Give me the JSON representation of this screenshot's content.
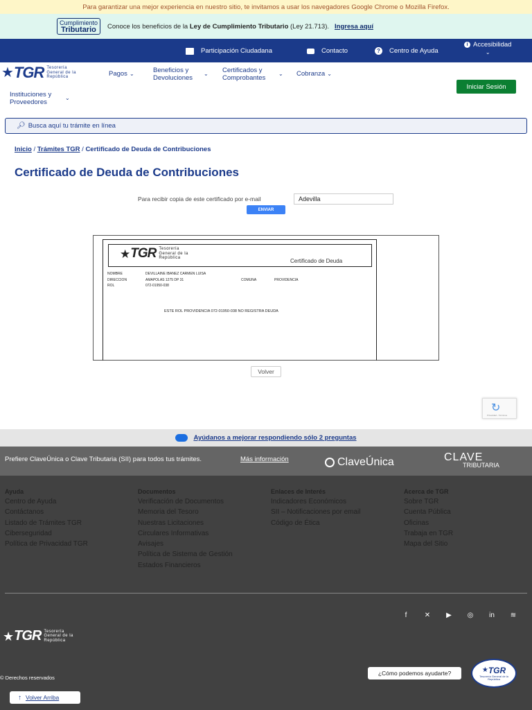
{
  "top_banner": {
    "text": "Para garantizar una mejor experiencia en nuestro sitio, te invitamos a usar los navegadores Google Chrome o Mozilla Firefox."
  },
  "ct_banner": {
    "logo_line1": "Cumplimiento",
    "logo_line2": "Tributario",
    "text_prefix": "Conoce los beneficios de la ",
    "text_bold": "Ley de Cumplimiento Tributario",
    "text_suffix": " (Ley 21.713).",
    "link": "Ingresa aquí"
  },
  "topbar": {
    "participacion": "Participación Ciudadana",
    "contacto": "Contacto",
    "centro_ayuda": "Centro de Ayuda",
    "accesibilidad": "Accesibilidad"
  },
  "logo": {
    "name": "TGR",
    "line1": "Tesorería",
    "line2": "General de la",
    "line3": "República"
  },
  "nav": {
    "pagos": "Pagos",
    "beneficios_1": "Beneficios y",
    "beneficios_2": "Devoluciones",
    "certificados_1": "Certificados y",
    "certificados_2": "Comprobantes",
    "cobranza": "Cobranza",
    "instituciones_1": "Instituciones y",
    "instituciones_2": "Proveedores",
    "login": "Iniciar Sesión"
  },
  "search": {
    "placeholder": "Busca aquí tu trámite en línea"
  },
  "breadcrumb": {
    "inicio": "Inicio",
    "tramites": "Trámites TGR",
    "current": "Certificado de Deuda de Contribuciones",
    "sep": "/"
  },
  "page": {
    "title": "Certificado de Deuda de Contribuciones",
    "email_label": "Para recibir copia de este certificado por e-mail",
    "email_value": "Adevilla",
    "enviar": "ENVIAR",
    "volver": "Volver"
  },
  "certificate": {
    "logo": "TGR",
    "logo_line1": "Tesorería",
    "logo_line2": "General de la",
    "logo_line3": "República",
    "doc_title": "Certificado de Deuda",
    "nombre_label": "NOMBRE",
    "nombre_value": "DEVILLAINE IBANEZ CARMEN LUISA",
    "direccion_label": "DIRECCION",
    "direccion_value": "AMAPOLAS 1275 DP 31",
    "comuna_label": "COMUNA",
    "comuna_value": "PROVIDENCIA",
    "rol_label": "ROL",
    "rol_value": "072-01950-038",
    "message": "ESTE ROL PROVIDENCIA 072-01950-038 NO REGISTRA DEUDA"
  },
  "recaptcha": {
    "text": "Privacidad - Términos"
  },
  "feedback": {
    "text": "Ayúdanos a mejorar respondiendo sólo 2 preguntas"
  },
  "clave": {
    "text": "Prefiere ClaveÚnica o Clave Tributaria (SII) para todos tus trámites.",
    "link": "Más información",
    "claveunica": "ClaveÚnica",
    "clave_tributaria_1": "CLAVE",
    "clave_tributaria_2": "TRIBUTARIA"
  },
  "footer": {
    "ayuda": {
      "heading": "Ayuda",
      "links": [
        "Centro de Ayuda",
        "Contáctanos",
        "Listado de Trámites TGR",
        "Ciberseguridad",
        "Política de Privacidad TGR"
      ]
    },
    "documentos": {
      "heading": "Documentos",
      "links": [
        "Verificación de Documentos",
        "Memoria del Tesoro",
        "Nuestras Licitaciones",
        "Circulares Informativas",
        "Avisajes",
        "Política de Sistema de Gestión",
        "Estados Financieros"
      ]
    },
    "enlaces": {
      "heading": "Enlaces de Interés",
      "links": [
        "Indicadores Económicos",
        "SII – Notificaciones por email",
        "Código de Ética"
      ]
    },
    "acerca": {
      "heading": "Acerca de TGR",
      "links": [
        "Sobre TGR",
        "Cuenta Pública",
        "Oficinas",
        "Trabaja en TGR",
        "Mapa del Sitio"
      ]
    },
    "rights": "© Derechos reservados",
    "volver_arriba": "Volver Arriba",
    "chat": "¿Cómo podemos ayudarte?"
  },
  "colors": {
    "primary": "#1b3a8a",
    "login_green": "#0b7f32",
    "footer_bg": "#414141"
  }
}
